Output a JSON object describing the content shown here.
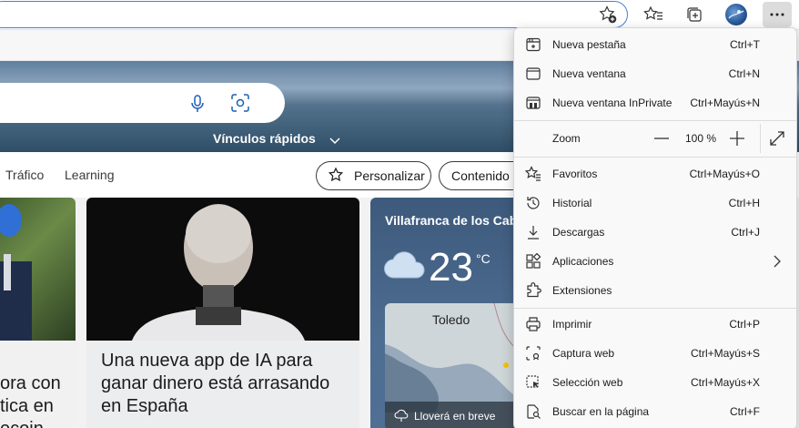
{
  "menu": {
    "items": [
      {
        "label": "Nueva pestaña",
        "shortcut": "Ctrl+T",
        "icon": "new-tab-icon"
      },
      {
        "label": "Nueva ventana",
        "shortcut": "Ctrl+N",
        "icon": "new-window-icon"
      },
      {
        "label": "Nueva ventana InPrivate",
        "shortcut": "Ctrl+Mayús+N",
        "icon": "inprivate-icon"
      },
      {
        "label": "Favoritos",
        "shortcut": "Ctrl+Mayús+O",
        "icon": "favorites-star-icon"
      },
      {
        "label": "Historial",
        "shortcut": "Ctrl+H",
        "icon": "history-icon"
      },
      {
        "label": "Descargas",
        "shortcut": "Ctrl+J",
        "icon": "download-icon"
      },
      {
        "label": "Aplicaciones",
        "shortcut": "",
        "icon": "apps-icon"
      },
      {
        "label": "Extensiones",
        "shortcut": "",
        "icon": "extensions-puzzle-icon"
      },
      {
        "label": "Imprimir",
        "shortcut": "Ctrl+P",
        "icon": "print-icon"
      },
      {
        "label": "Captura web",
        "shortcut": "Ctrl+Mayús+S",
        "icon": "web-capture-icon"
      },
      {
        "label": "Selección web",
        "shortcut": "Ctrl+Mayús+X",
        "icon": "web-select-icon"
      },
      {
        "label": "Buscar en la página",
        "shortcut": "Ctrl+F",
        "icon": "find-in-page-icon"
      }
    ],
    "zoom": {
      "label": "Zoom",
      "value": "100 %"
    }
  },
  "hero": {
    "quick_links": "Vínculos rápidos"
  },
  "nav": {
    "items": [
      "Tráfico",
      "Learning"
    ],
    "personalize": "Personalizar",
    "content": "Contenido"
  },
  "cards": {
    "left_text": [
      "ora con",
      "tica en",
      "ecoin"
    ],
    "mid_headline": "Una nueva app de IA para ganar dinero está arrasando en España",
    "weather": {
      "location": "Villafranca de los Caba",
      "temp": "23",
      "unit": "°C",
      "map_label": "Toledo",
      "forecast": "Lloverá en breve"
    }
  },
  "colors": {
    "address_border": "#4a7fd0",
    "menu_bg": "#f9f9f9",
    "more_button_active": "#dcdcdc"
  }
}
